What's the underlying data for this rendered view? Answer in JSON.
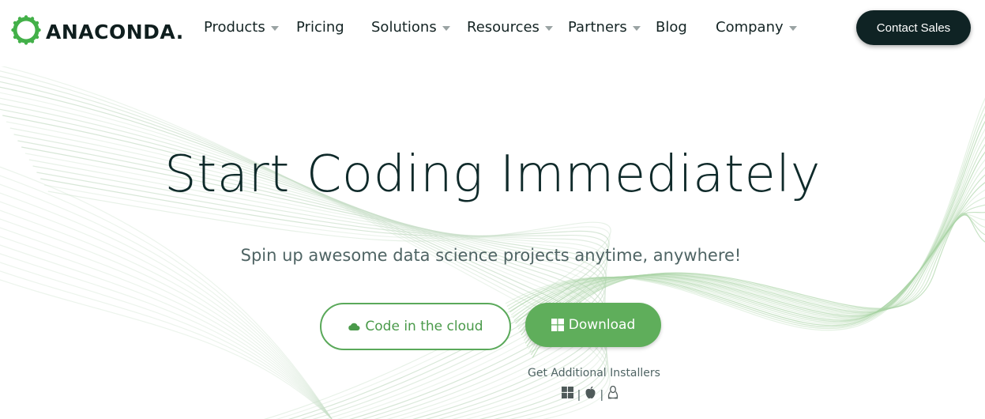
{
  "brand": {
    "name": "ANACONDA.",
    "logo_icon": "anaconda-ring-icon",
    "accent": "#43b049"
  },
  "nav": {
    "items": [
      {
        "label": "Products",
        "has_dropdown": true
      },
      {
        "label": "Pricing",
        "has_dropdown": false
      },
      {
        "label": "Solutions",
        "has_dropdown": true
      },
      {
        "label": "Resources",
        "has_dropdown": true
      },
      {
        "label": "Partners",
        "has_dropdown": true
      },
      {
        "label": "Blog",
        "has_dropdown": false
      },
      {
        "label": "Company",
        "has_dropdown": true
      }
    ],
    "cta_label": "Contact Sales",
    "cta_color": "#0f2324"
  },
  "hero": {
    "title": "Start Coding Immediately",
    "subtitle": "Spin up awesome data science projects anytime, anywhere!",
    "cloud_button": {
      "label": "Code in the cloud",
      "icon": "cloud-icon"
    },
    "download_button": {
      "label": "Download",
      "icon": "windows-icon",
      "color": "#5fae5b"
    },
    "installers_label": "Get Additional Installers",
    "installers": [
      {
        "icon": "windows-icon"
      },
      {
        "icon": "apple-icon"
      },
      {
        "icon": "linux-icon"
      }
    ],
    "installer_separator": "|"
  }
}
